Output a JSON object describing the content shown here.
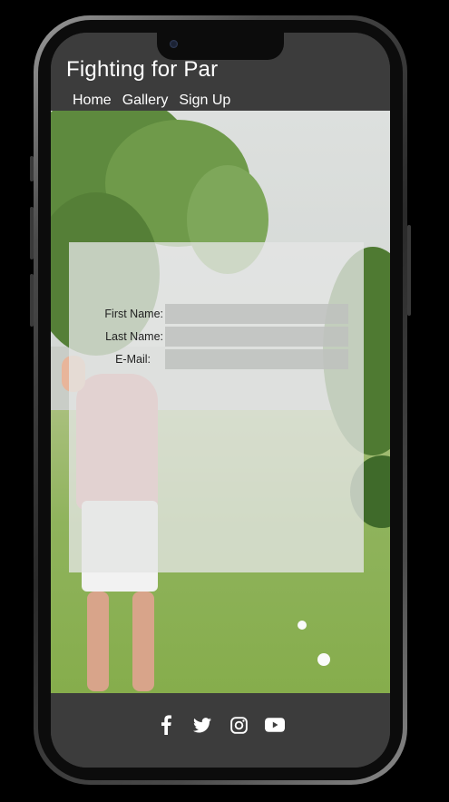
{
  "header": {
    "title": "Fighting for Par",
    "nav": [
      "Home",
      "Gallery",
      "Sign Up"
    ]
  },
  "form": {
    "first_name_label": "First Name:",
    "last_name_label": "Last Name:",
    "email_label": "E-Mail:",
    "first_name_value": "",
    "last_name_value": "",
    "email_value": ""
  },
  "footer": {
    "icons": [
      "facebook-icon",
      "twitter-icon",
      "instagram-icon",
      "youtube-icon"
    ]
  },
  "colors": {
    "header_bg": "#3c3c3c",
    "text": "#ffffff"
  }
}
